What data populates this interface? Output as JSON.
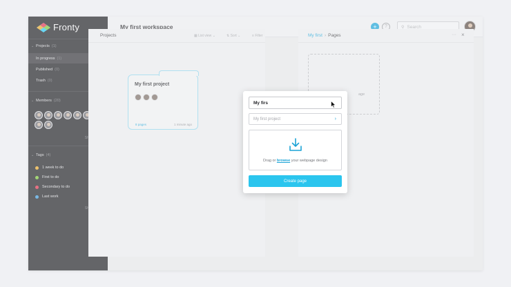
{
  "app": {
    "brand": "Fronty"
  },
  "colors": {
    "accent": "#1ba3d6",
    "button": "#2bc5ee",
    "sidebar_bg": "#222327"
  },
  "sidebar": {
    "projects": {
      "title": "Projects",
      "count": "(1)",
      "items": [
        {
          "label": "In progress",
          "count": "(1)"
        },
        {
          "label": "Published",
          "count": "(0)"
        },
        {
          "label": "Trash",
          "count": "(0)"
        }
      ]
    },
    "members": {
      "title": "Members",
      "count": "(20)",
      "avatar_count": 9,
      "show_more": "Show more"
    },
    "tags": {
      "title": "Tags",
      "count": "(4)",
      "items": [
        {
          "label": "1 week to do",
          "color": "#e6a82e"
        },
        {
          "label": "First to do",
          "color": "#7cc43c"
        },
        {
          "label": "Secondary to do",
          "color": "#e0344f"
        },
        {
          "label": "Last work",
          "color": "#3f9ad8"
        }
      ],
      "show_more": "Show more"
    }
  },
  "topbar": {
    "title": "My first workspace",
    "search_placeholder": "Search",
    "add_icon": "plus-icon",
    "help_icon": "question-icon"
  },
  "projects_panel": {
    "title": "Projects",
    "controls": {
      "view": "List view",
      "sort": "Sort",
      "filter": "Filter"
    },
    "card": {
      "title": "My first project",
      "pages": "8 pages",
      "updated": "1 minute ago"
    }
  },
  "pages_panel": {
    "breadcrumb": {
      "parent": "My first",
      "current": "Pages"
    },
    "new_page_fragment": "age"
  },
  "modal": {
    "name_value": "My firs",
    "project_select": "My first project",
    "drop_prefix": "Drag or",
    "drop_link": "browse",
    "drop_suffix": "your webpage design",
    "submit": "Create page"
  }
}
